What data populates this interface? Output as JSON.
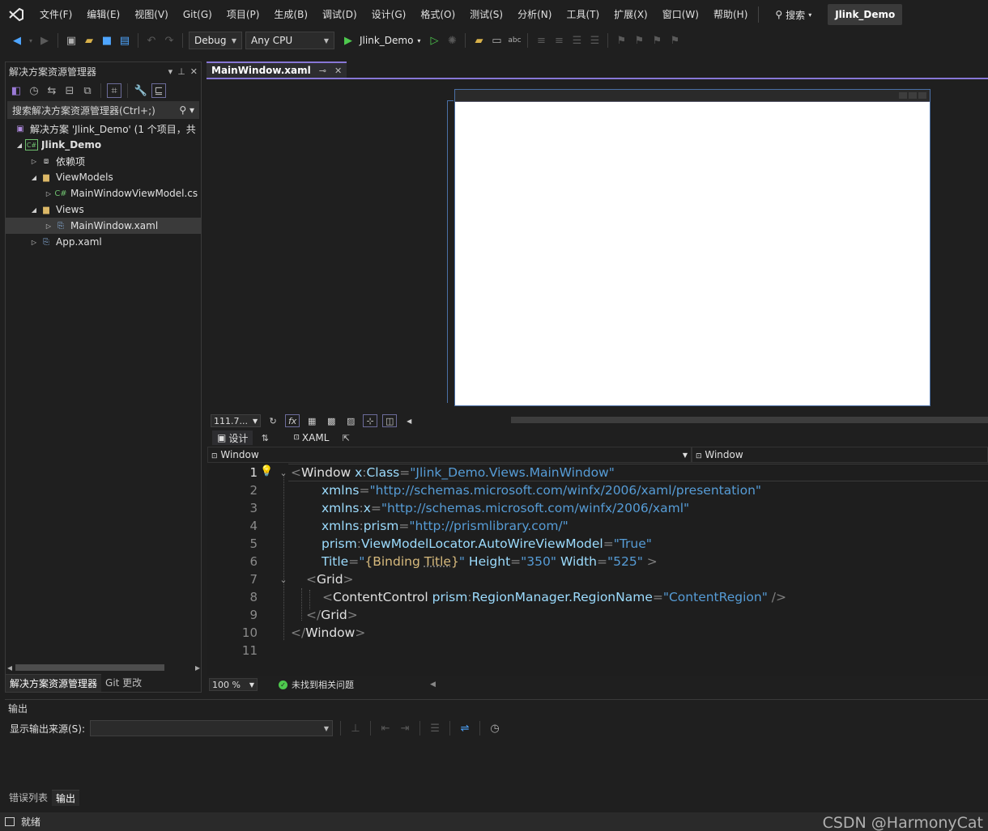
{
  "menubar": {
    "items": [
      "文件(F)",
      "编辑(E)",
      "视图(V)",
      "Git(G)",
      "项目(P)",
      "生成(B)",
      "调试(D)",
      "设计(G)",
      "格式(O)",
      "测试(S)",
      "分析(N)",
      "工具(T)",
      "扩展(X)",
      "窗口(W)",
      "帮助(H)"
    ],
    "search_label": "搜索",
    "project_name": "Jlink_Demo"
  },
  "toolbar": {
    "configuration": "Debug",
    "platform": "Any CPU",
    "run_target": "Jlink_Demo"
  },
  "solution_explorer": {
    "title": "解决方案资源管理器",
    "search_placeholder": "搜索解决方案资源管理器(Ctrl+;)",
    "tree": [
      {
        "label": "解决方案 'Jlink_Demo' (1 个项目，共",
        "icon": "solution-icon",
        "level": 0,
        "arrow": ""
      },
      {
        "label": "Jlink_Demo",
        "icon": "csharp-project-icon",
        "level": 0,
        "arrow": "expanded",
        "bold": true
      },
      {
        "label": "依赖项",
        "icon": "dependencies-icon",
        "level": 1,
        "arrow": "collapsed"
      },
      {
        "label": "ViewModels",
        "icon": "folder-icon",
        "level": 1,
        "arrow": "expanded"
      },
      {
        "label": "MainWindowViewModel.cs",
        "icon": "csharp-file-icon",
        "level": 2,
        "arrow": "collapsed"
      },
      {
        "label": "Views",
        "icon": "folder-icon",
        "level": 1,
        "arrow": "expanded"
      },
      {
        "label": "MainWindow.xaml",
        "icon": "xaml-file-icon",
        "level": 2,
        "arrow": "collapsed",
        "selected": true
      },
      {
        "label": "App.xaml",
        "icon": "xaml-file-icon",
        "level": 1,
        "arrow": "collapsed"
      }
    ],
    "tabs": [
      "解决方案资源管理器",
      "Git 更改"
    ]
  },
  "document": {
    "tab_label": "MainWindow.xaml",
    "designer_zoom": "111.7...",
    "split_tabs": [
      "设计",
      "XAML"
    ],
    "nav_left": "Window",
    "nav_right": "Window",
    "editor_zoom": "100 %",
    "issues_text": "未找到相关问题"
  },
  "code": {
    "line_numbers": [
      "1",
      "2",
      "3",
      "4",
      "5",
      "6",
      "7",
      "8",
      "9",
      "10",
      "11"
    ],
    "l1": {
      "lt": "<",
      "tag": "Window",
      "sp": " ",
      "ns": "x",
      "colon": ":",
      "attr": "Class",
      "eq": "=",
      "val": "\"Jlink_Demo.Views.MainWindow\""
    },
    "l2": {
      "attr": "xmlns",
      "eq": "=",
      "val": "\"http://schemas.microsoft.com/winfx/2006/xaml/presentation\""
    },
    "l3": {
      "attr": "xmlns",
      "colon": ":",
      "ns": "x",
      "eq": "=",
      "val": "\"http://schemas.microsoft.com/winfx/2006/xaml\""
    },
    "l4": {
      "attr": "xmlns",
      "colon": ":",
      "ns": "prism",
      "eq": "=",
      "val": "\"http://prismlibrary.com/\""
    },
    "l5": {
      "ns": "prism",
      "colon": ":",
      "attr": "ViewModelLocator.AutoWireViewModel",
      "eq": "=",
      "val": "\"True\""
    },
    "l6": {
      "attr1": "Title",
      "eq": "=",
      "q": "\"",
      "b1": "{",
      "bind": "Binding",
      "sp": " ",
      "bindprop": "Title",
      "b2": "}",
      "attr2": "Height",
      "val2": "\"350\"",
      "attr3": "Width",
      "val3": "\"525\"",
      "gt": " >"
    },
    "l7": {
      "lt": "<",
      "tag": "Grid",
      "gt": ">"
    },
    "l8": {
      "lt": "<",
      "tag": "ContentControl",
      "ns": "prism",
      "colon": ":",
      "attr": "RegionManager.RegionName",
      "eq": "=",
      "val": "\"ContentRegion\"",
      "end": " />"
    },
    "l9": {
      "lt": "</",
      "tag": "Grid",
      "gt": ">"
    },
    "l10": {
      "lt": "</",
      "tag": "Window",
      "gt": ">"
    }
  },
  "output": {
    "title": "输出",
    "source_label": "显示输出来源(S):",
    "source_value": "",
    "tabs": [
      "错误列表",
      "输出"
    ]
  },
  "status": {
    "text": "就绪",
    "watermark": "CSDN @HarmonyCat"
  }
}
